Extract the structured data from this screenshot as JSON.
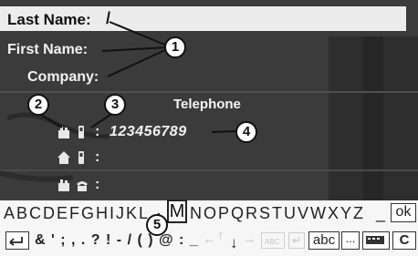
{
  "form": {
    "last_name_label": "Last Name:",
    "last_name_value": "/",
    "first_name_label": "First Name:",
    "company_label": "Company:"
  },
  "telephone": {
    "title": "Telephone",
    "rows": [
      {
        "colon": ":",
        "number": "123456789",
        "icon": "business-mobile-phone-icon"
      },
      {
        "colon": ":",
        "number": "",
        "icon": "home-mobile-phone-icon"
      },
      {
        "colon": ":",
        "number": "",
        "icon": "business-landline-phone-icon"
      }
    ]
  },
  "keyboard": {
    "alpha_left": "ABCDEFGHIJK",
    "alpha_cursor": "L",
    "selected_key": "M",
    "alpha_right": "NOPQRSTUVWXYZ",
    "underscore": "_",
    "ok_label": "ok",
    "symbols": "& ' ; , . ? ! - / ( ) @ : _",
    "abc_label": "abc",
    "ellipsis_label": "...",
    "clear_label": "C"
  },
  "callouts": [
    "1",
    "2",
    "3",
    "4",
    "5"
  ]
}
